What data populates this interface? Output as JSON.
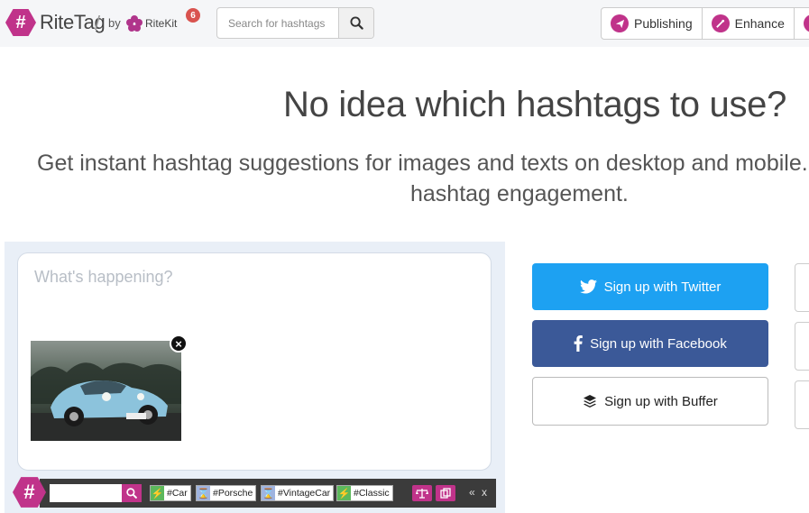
{
  "header": {
    "logo_text": "RiteTag",
    "by_text": "by",
    "ritekit_text": "RiteKit",
    "notification_count": "6",
    "search": {
      "placeholder": "Search for hashtags",
      "value": ""
    },
    "nav": [
      {
        "label": "Publishing",
        "icon": "paper-plane-icon"
      },
      {
        "label": "Enhance",
        "icon": "magic-wand-icon"
      },
      {
        "label": "",
        "icon": "hand-icon"
      }
    ]
  },
  "hero": {
    "title": "No idea which hashtags to use?",
    "subtitle_line1": "Get instant hashtag suggestions for images and texts on desktop and mobile.",
    "subtitle_line2": "hashtag engagement."
  },
  "composer": {
    "placeholder": "What's happening?",
    "image_alt": "Light blue vintage Porsche car",
    "remove_icon": "close-circle-icon"
  },
  "tagbar": {
    "logo_symbol": "#",
    "input_value": "",
    "tags": [
      {
        "label": "#Car",
        "status": "hot",
        "marker_color": "#5cb85c",
        "marker_symbol": "⚡"
      },
      {
        "label": "#Porsche",
        "status": "overused",
        "marker_color": "#9fb4e0",
        "marker_symbol": "⌛"
      },
      {
        "label": "#VintageCar",
        "status": "overused",
        "marker_color": "#9fb4e0",
        "marker_symbol": "⌛"
      },
      {
        "label": "#Classic",
        "status": "hot",
        "marker_color": "#5cb85c",
        "marker_symbol": "⚡"
      }
    ],
    "collapse_text": "«",
    "close_text": "x"
  },
  "signup": {
    "twitter_label": "Sign up with Twitter",
    "facebook_label": "Sign up with Facebook",
    "buffer_label": "Sign up with Buffer"
  },
  "colors": {
    "brand": "#c0338a",
    "twitter": "#1da1f2",
    "facebook": "#3b5998"
  }
}
